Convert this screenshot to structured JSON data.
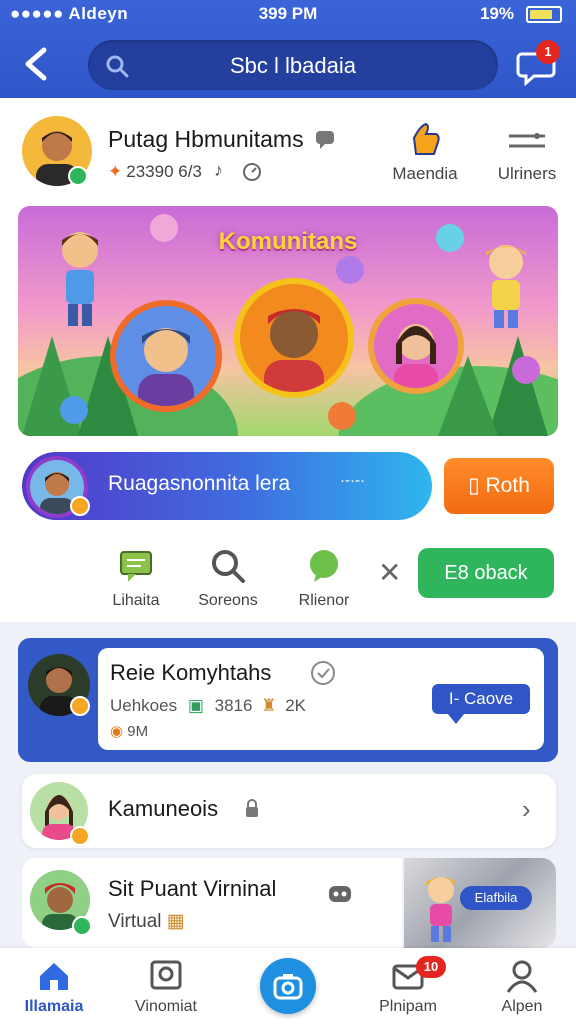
{
  "status_bar": {
    "carrier": "●●●●● Aldeyn",
    "time": "399 PM",
    "battery_text": "19%"
  },
  "header": {
    "search_text": "Sbc l lbadaia",
    "chat_badge": "1"
  },
  "profile": {
    "title": "Putag Hbmunitams",
    "stats": "23390 6/3"
  },
  "media_button": {
    "label": "Maendia",
    "icon": "thumbs-up-icon"
  },
  "users_button": {
    "label": "Ulriners",
    "icon": "toggle-icon"
  },
  "banner": {
    "title": "Komunitans"
  },
  "community": {
    "label": "Ruagasnonnita lera",
    "dots": "·-·-·",
    "join_label": "Roth",
    "join_icon": "calendar-icon"
  },
  "actions": [
    {
      "label": "Lihaita",
      "icon": "chat-icon"
    },
    {
      "label": "Soreons",
      "icon": "search-icon"
    },
    {
      "label": "Rlienor",
      "icon": "heart-bubble-icon"
    }
  ],
  "book_button": {
    "label": "E8 oback"
  },
  "featured": {
    "title": "Reie Komyhtahs",
    "meta": "Uehkoes",
    "meta_count": "3816",
    "meta_k": "2K",
    "views": "9M",
    "tag": "I- Caove"
  },
  "list_items": [
    {
      "label": "Kamuneois"
    },
    {
      "title": "Sit Puant Virninal",
      "subtitle": "Virtual",
      "thumb_chip": "Elafbila"
    }
  ],
  "bottom_nav": [
    {
      "label": "Illamaia",
      "icon": "home-icon",
      "active": true
    },
    {
      "label": "Vinomiat",
      "icon": "frame-icon"
    },
    {
      "label": "",
      "icon": "camera-icon"
    },
    {
      "label": "Plnipam",
      "icon": "mail-icon",
      "badge": "10"
    },
    {
      "label": "Alpen",
      "icon": "user-icon"
    }
  ],
  "colors": {
    "primary": "#2f56c8",
    "accent_orange": "#f26b10",
    "accent_green": "#2fb55c",
    "badge_red": "#e52520"
  }
}
